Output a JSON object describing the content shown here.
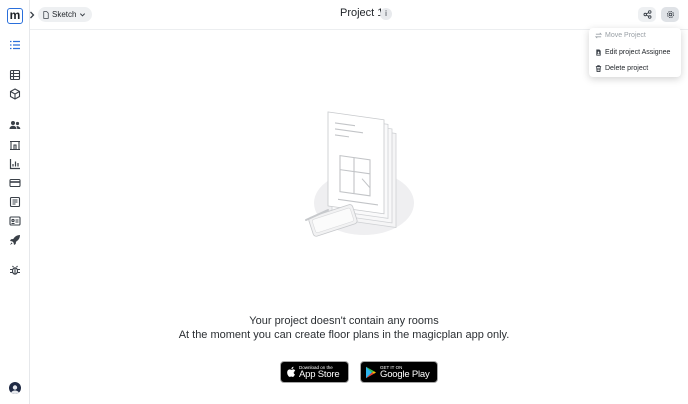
{
  "app": {
    "logo_letter": "m"
  },
  "header": {
    "breadcrumb_button": "Sketch",
    "title": "Project 1",
    "info_icon": "i"
  },
  "settings_menu": {
    "items": [
      {
        "label": "Move Project",
        "icon": "swap-icon",
        "disabled": true
      },
      {
        "label": "Edit project Assignee",
        "icon": "file-user-icon",
        "disabled": false
      },
      {
        "label": "Delete project",
        "icon": "trash-icon",
        "disabled": false
      }
    ]
  },
  "sidebar": {
    "items": [
      "list-icon",
      "table-icon",
      "cube-icon",
      "users-icon",
      "building-icon",
      "chart-icon",
      "card-icon",
      "form-icon",
      "id-card-icon",
      "rocket-icon",
      "bug-icon"
    ]
  },
  "empty_state": {
    "line1": "Your project doesn't contain any rooms",
    "line2": "At the moment you can create floor plans in the magicplan app only."
  },
  "stores": {
    "apple_small": "Download on the",
    "apple_big": "App Store",
    "google_small": "GET IT ON",
    "google_big": "Google Play"
  },
  "colors": {
    "accent": "#2a6fdb"
  }
}
